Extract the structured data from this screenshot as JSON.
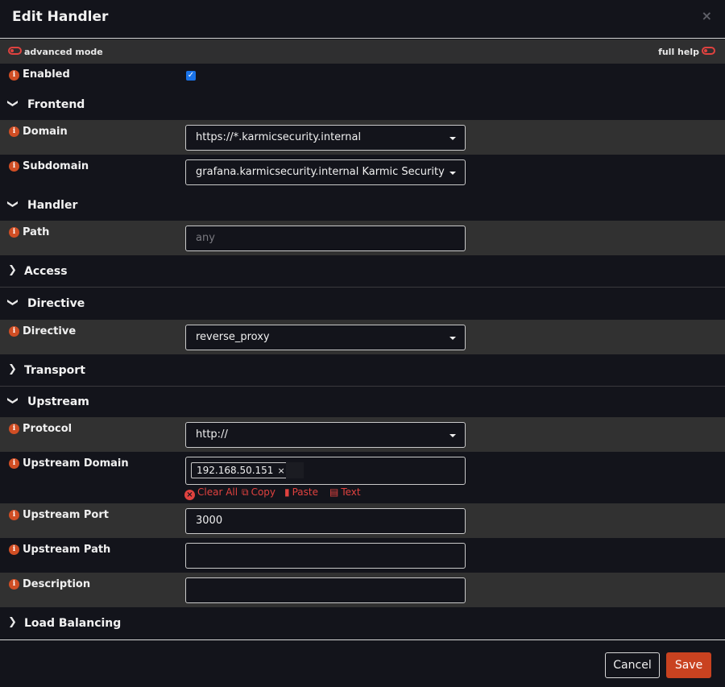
{
  "header": {
    "title": "Edit Handler",
    "close": "×"
  },
  "modebar": {
    "advanced_label": "advanced mode",
    "help_label": "full help"
  },
  "fields": {
    "enabled": {
      "label": "Enabled",
      "checked": true
    },
    "domain": {
      "label": "Domain",
      "value": "https://*.karmicsecurity.internal"
    },
    "subdomain": {
      "label": "Subdomain",
      "value": "grafana.karmicsecurity.internal Karmic Security Grafana"
    },
    "path": {
      "label": "Path",
      "placeholder": "any"
    },
    "directive": {
      "label": "Directive",
      "value": "reverse_proxy"
    },
    "protocol": {
      "label": "Protocol",
      "value": "http://"
    },
    "upstream_domain": {
      "label": "Upstream Domain",
      "tag": "192.168.50.151",
      "tag_remove": "×"
    },
    "upstream_port": {
      "label": "Upstream Port",
      "value": "3000"
    },
    "upstream_path": {
      "label": "Upstream Path",
      "value": ""
    },
    "description": {
      "label": "Description",
      "value": ""
    }
  },
  "sections": {
    "frontend": "Frontend",
    "handler": "Handler",
    "access": "Access",
    "directive": "Directive",
    "transport": "Transport",
    "upstream": "Upstream",
    "load_balancing": "Load Balancing"
  },
  "tag_actions": {
    "clear_all": "Clear All",
    "copy": "Copy",
    "paste": "Paste",
    "text": "Text"
  },
  "info_glyph": "i",
  "footer": {
    "cancel": "Cancel",
    "save": "Save"
  },
  "colors": {
    "accent": "#e0423f",
    "save_button": "#c94220",
    "info_icon": "#d04e24",
    "checkbox": "#1a73e8"
  }
}
